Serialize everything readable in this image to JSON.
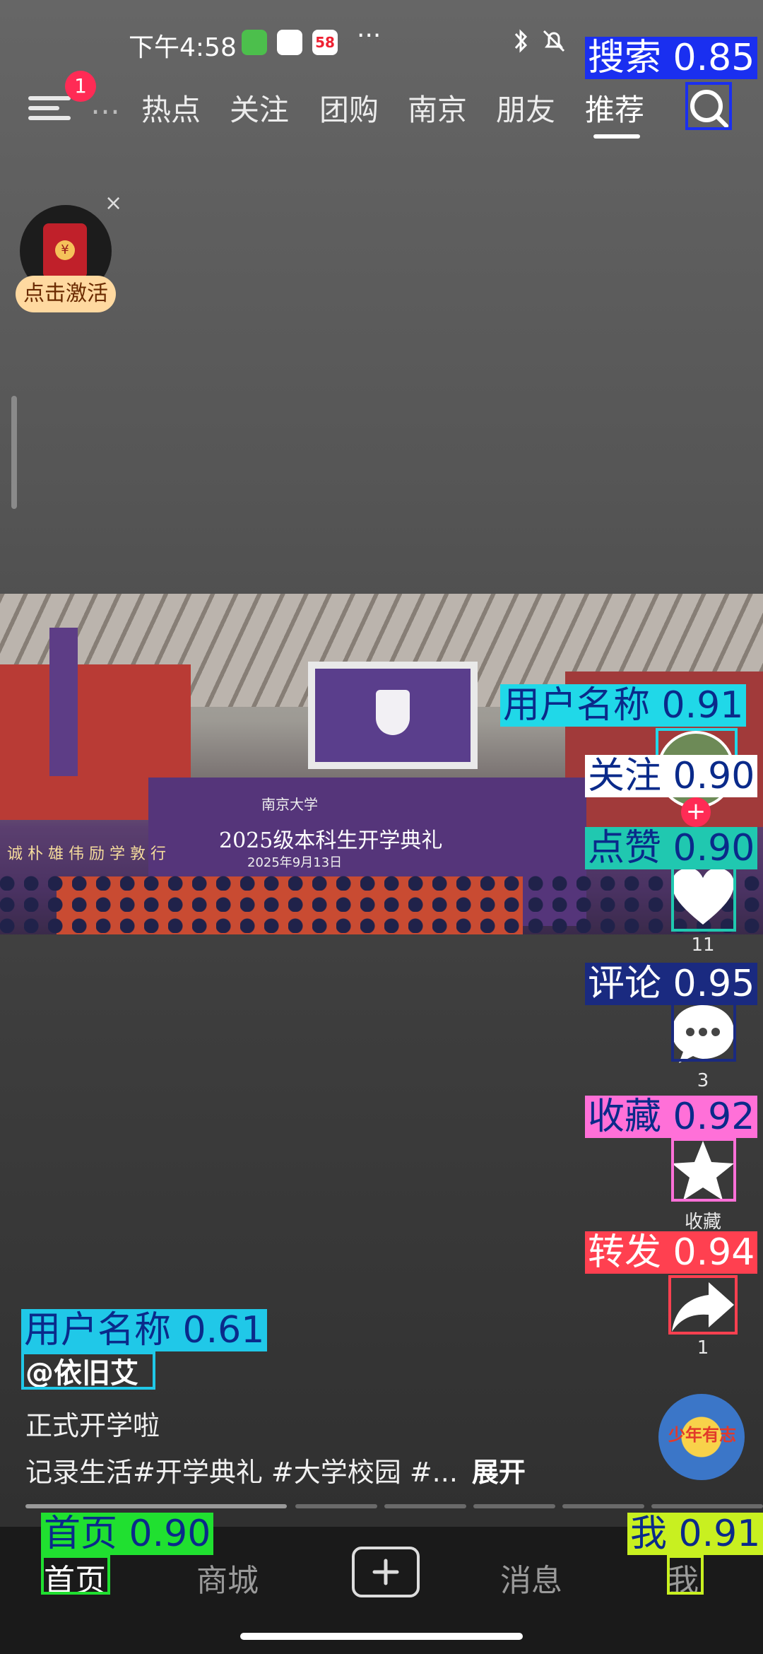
{
  "status_bar": {
    "time": "下午4:58",
    "more": "···",
    "mini_app_badge": "58"
  },
  "top_nav": {
    "menu_badge": "1",
    "partial_tab": "...",
    "tabs": [
      "热点",
      "关注",
      "团购",
      "南京",
      "朋友",
      "推荐"
    ],
    "active_tab": "推荐"
  },
  "red_packet": {
    "label": "点击激活",
    "close": "×",
    "coin": "¥"
  },
  "video": {
    "stage_title": "2025级本科生开学典礼",
    "stage_date": "2025年9月13日",
    "stage_school": "南京大学",
    "slogan": "诚 朴 雄 伟   励 学 敦 行"
  },
  "side_actions": {
    "follow_plus": "+",
    "likes": "11",
    "comments": "3",
    "favorite": "收藏",
    "shares": "1",
    "music_text": "少年有志"
  },
  "caption": {
    "author": "@依旧艾",
    "line1": "正式开学啦",
    "line2": "记录生活#开学典礼 #大学校园 #...",
    "more": "展开"
  },
  "bottom_nav": {
    "home": "首页",
    "mall": "商城",
    "messages": "消息",
    "me": "我"
  },
  "detections": [
    {
      "label": "搜索 0.85",
      "color": "#1a2ff0",
      "text_color": "#ffffff"
    },
    {
      "label": "用户名称 0.91",
      "color": "#20d8e8",
      "text_color": "#0a2a8a"
    },
    {
      "label": "关注 0.90",
      "color": "#ffffff",
      "text_color": "#0a2a8a"
    },
    {
      "label": "点赞 0.90",
      "color": "#20c8b0",
      "text_color": "#0a2a8a"
    },
    {
      "label": "评论 0.95",
      "color": "#1a2a80",
      "text_color": "#ffffff"
    },
    {
      "label": "收藏 0.92",
      "color": "#ff70d8",
      "text_color": "#0a2a8a"
    },
    {
      "label": "转发 0.94",
      "color": "#ff4050",
      "text_color": "#ffffff"
    },
    {
      "label": "用户名称 0.61",
      "color": "#20c8e8",
      "text_color": "#0a2a8a"
    },
    {
      "label": "首页 0.90",
      "color": "#20e030",
      "text_color": "#0a2a8a"
    },
    {
      "label": "我 0.91",
      "color": "#c8f020",
      "text_color": "#0a2a8a"
    }
  ]
}
